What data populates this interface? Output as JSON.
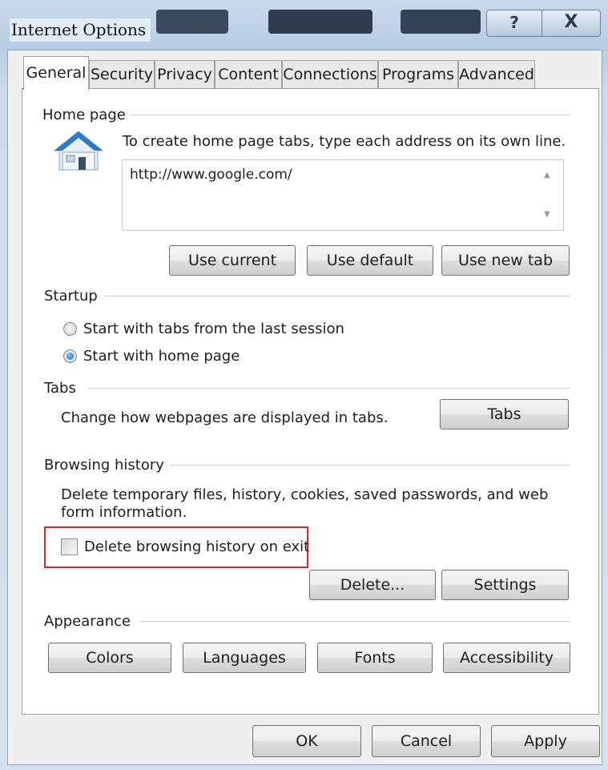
{
  "window": {
    "title": "Internet Options",
    "help_label": "?",
    "close_label": "X"
  },
  "tabs": [
    {
      "label": "General",
      "active": true
    },
    {
      "label": "Security"
    },
    {
      "label": "Privacy"
    },
    {
      "label": "Content"
    },
    {
      "label": "Connections"
    },
    {
      "label": "Programs"
    },
    {
      "label": "Advanced"
    }
  ],
  "home_page": {
    "heading": "Home page",
    "instruction": "To create home page tabs, type each address on its own line.",
    "value": "http://www.google.com/",
    "icon": "house-icon",
    "buttons": {
      "use_current": "Use current",
      "use_default": "Use default",
      "use_new_tab": "Use new tab"
    }
  },
  "startup": {
    "heading": "Startup",
    "options": [
      {
        "label": "Start with tabs from the last session",
        "selected": false
      },
      {
        "label": "Start with home page",
        "selected": true
      }
    ]
  },
  "tabs_group": {
    "heading": "Tabs",
    "description": "Change how webpages are displayed in tabs.",
    "button": "Tabs"
  },
  "browsing_history": {
    "heading": "Browsing history",
    "description_line1": "Delete temporary files, history, cookies, saved passwords, and web",
    "description_line2": "form information.",
    "checkbox_label": "Delete browsing history on exit",
    "checked": false,
    "delete_button": "Delete...",
    "settings_button": "Settings"
  },
  "appearance": {
    "heading": "Appearance",
    "buttons": {
      "colors": "Colors",
      "languages": "Languages",
      "fonts": "Fonts",
      "accessibility": "Accessibility"
    }
  },
  "footer": {
    "ok": "OK",
    "cancel": "Cancel",
    "apply": "Apply"
  },
  "colors": {
    "highlight": "#d9262c",
    "radio_selected": "#1f6bbf"
  }
}
